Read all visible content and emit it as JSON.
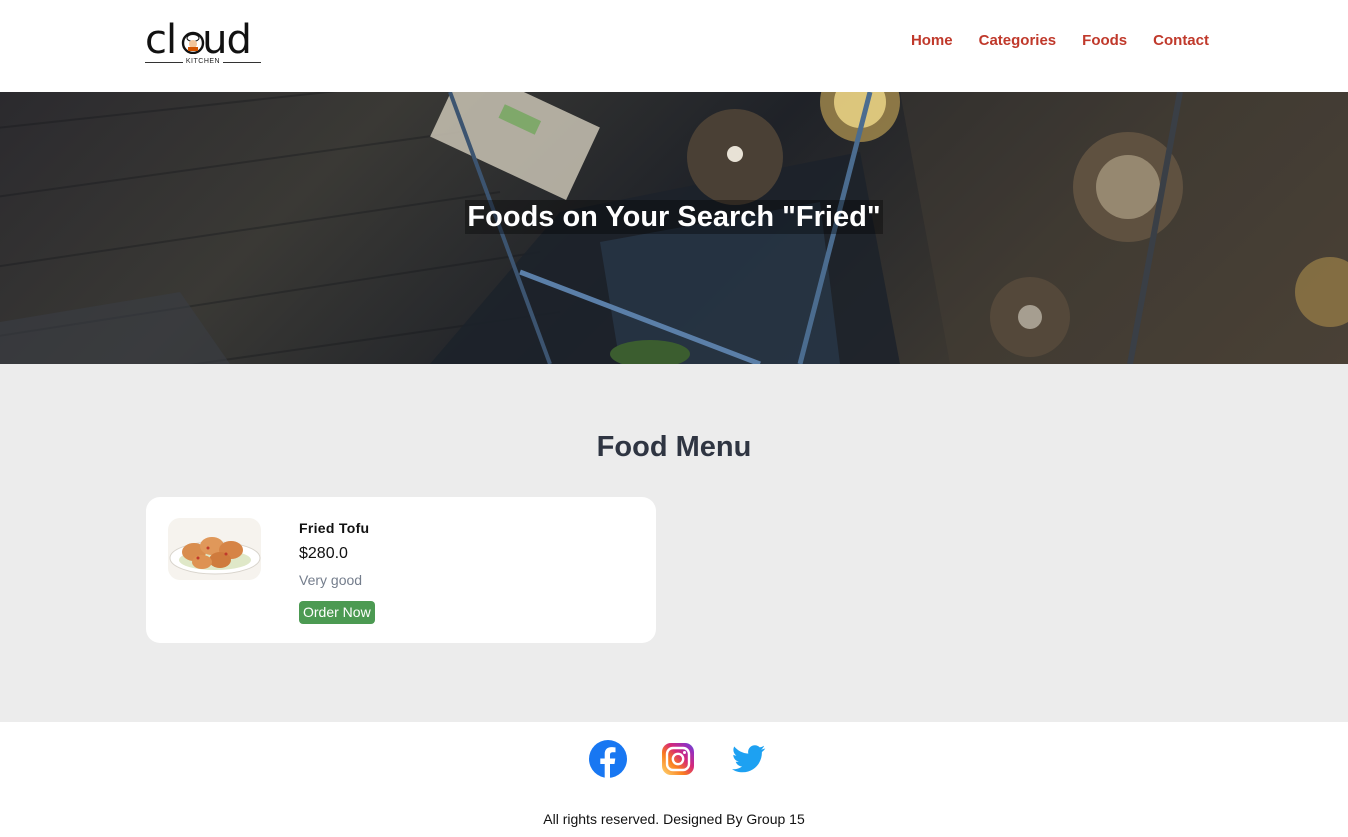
{
  "header": {
    "logo_text": "cloud",
    "logo_subtext": "KITCHEN",
    "nav": [
      "Home",
      "Categories",
      "Foods",
      "Contact"
    ]
  },
  "hero": {
    "title": "Foods on Your Search \"Fried\""
  },
  "food_menu": {
    "title": "Food Menu",
    "items": [
      {
        "name": "Fried Tofu",
        "price": "$280.0",
        "description": "Very good",
        "button": "Order Now"
      }
    ]
  },
  "footer": {
    "social": [
      "facebook-icon",
      "instagram-icon",
      "twitter-icon"
    ],
    "copyright": "All rights reserved. Designed By Group 15"
  },
  "colors": {
    "nav_link": "#c0392b",
    "section_bg": "#ececec",
    "button": "#4c9a52",
    "heading": "#2f3542"
  }
}
